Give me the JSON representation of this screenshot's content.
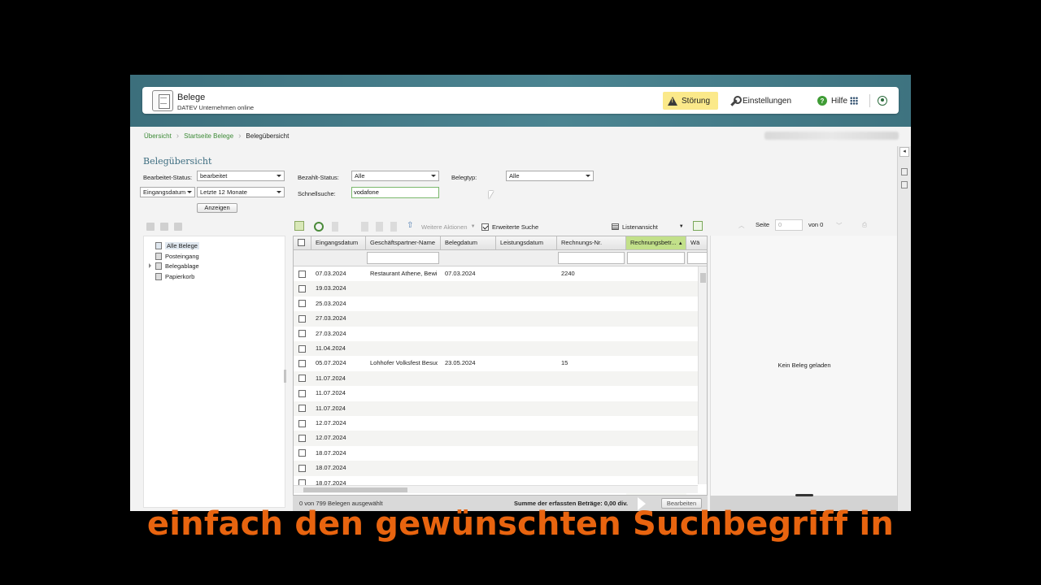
{
  "header": {
    "app_title": "Belege",
    "app_subtitle": "DATEV Unternehmen online",
    "stoerung_label": "Störung",
    "einstellungen_label": "Einstellungen",
    "hilfe_label": "Hilfe"
  },
  "breadcrumb": [
    "Übersicht",
    "Startseite Belege",
    "Belegübersicht"
  ],
  "page_title": "Belegübersicht",
  "filters": {
    "bearbeitet_label": "Bearbeitet-Status:",
    "bearbeitet_value": "bearbeitet",
    "bezahlt_label": "Bezahlt-Status:",
    "bezahlt_value": "Alle",
    "belegtyp_label": "Belegtyp:",
    "belegtyp_value": "Alle",
    "datum_field_value": "Eingangsdatum",
    "datum_range_value": "Letzte 12 Monate",
    "schnellsuche_label": "Schnellsuche:",
    "schnellsuche_value": "vodafone",
    "anzeigen_label": "Anzeigen"
  },
  "tree": {
    "items": [
      "Alle Belege",
      "Posteingang",
      "Belegablage",
      "Papierkorb"
    ],
    "selected": "Alle Belege"
  },
  "grid_toolbar": {
    "weitere_aktionen": "Weitere Aktionen",
    "erweiterte_suche": "Erweiterte Suche",
    "erweiterte_suche_checked": true,
    "ansicht": "Listenansicht"
  },
  "pager": {
    "seite_label": "Seite",
    "seite_value": "0",
    "von_label": "von 0"
  },
  "grid": {
    "columns": [
      "Eingangsdatum",
      "Geschäftspartner-Name",
      "Belegdatum",
      "Leistungsdatum",
      "Rechnungs-Nr.",
      "Rechnungsbetr...",
      "Wä"
    ],
    "sorted_column": "Rechnungsbetr...",
    "rows": [
      {
        "eingang": "07.03.2024",
        "partner": "Restaurant Athene, Bewi",
        "belegdatum": "07.03.2024",
        "leistung": "",
        "nr": "2240",
        "betrag": ""
      },
      {
        "eingang": "19.03.2024",
        "partner": "",
        "belegdatum": "",
        "leistung": "",
        "nr": "",
        "betrag": ""
      },
      {
        "eingang": "25.03.2024",
        "partner": "",
        "belegdatum": "",
        "leistung": "",
        "nr": "",
        "betrag": ""
      },
      {
        "eingang": "27.03.2024",
        "partner": "",
        "belegdatum": "",
        "leistung": "",
        "nr": "",
        "betrag": ""
      },
      {
        "eingang": "27.03.2024",
        "partner": "",
        "belegdatum": "",
        "leistung": "",
        "nr": "",
        "betrag": ""
      },
      {
        "eingang": "11.04.2024",
        "partner": "",
        "belegdatum": "",
        "leistung": "",
        "nr": "",
        "betrag": ""
      },
      {
        "eingang": "05.07.2024",
        "partner": "Lohhofer Volksfest Besuc",
        "belegdatum": "23.05.2024",
        "leistung": "",
        "nr": "15",
        "betrag": ""
      },
      {
        "eingang": "11.07.2024",
        "partner": "",
        "belegdatum": "",
        "leistung": "",
        "nr": "",
        "betrag": ""
      },
      {
        "eingang": "11.07.2024",
        "partner": "",
        "belegdatum": "",
        "leistung": "",
        "nr": "",
        "betrag": ""
      },
      {
        "eingang": "11.07.2024",
        "partner": "",
        "belegdatum": "",
        "leistung": "",
        "nr": "",
        "betrag": ""
      },
      {
        "eingang": "12.07.2024",
        "partner": "",
        "belegdatum": "",
        "leistung": "",
        "nr": "",
        "betrag": ""
      },
      {
        "eingang": "12.07.2024",
        "partner": "",
        "belegdatum": "",
        "leistung": "",
        "nr": "",
        "betrag": ""
      },
      {
        "eingang": "18.07.2024",
        "partner": "",
        "belegdatum": "",
        "leistung": "",
        "nr": "",
        "betrag": ""
      },
      {
        "eingang": "18.07.2024",
        "partner": "",
        "belegdatum": "",
        "leistung": "",
        "nr": "",
        "betrag": ""
      },
      {
        "eingang": "18.07.2024",
        "partner": "",
        "belegdatum": "",
        "leistung": "",
        "nr": "",
        "betrag": ""
      }
    ]
  },
  "statusbar": {
    "selection": "0 von 799 Belegen ausgewählt",
    "summe": "Summe der erfassten Beträge: 0,00 div.",
    "bearbeiten": "Bearbeiten"
  },
  "preview": {
    "empty_message": "Kein Beleg geladen"
  },
  "subtitle": "einfach den gewünschten Suchbegriff in",
  "colors": {
    "banner": "#4b8491",
    "accent_green": "#3c8a36",
    "stoerung_bg": "#fbe98a",
    "sorted_header": "#c2e08a",
    "subtitle": "#e8640f"
  },
  "icons": [
    "document-icon",
    "warning-icon",
    "wrench-icon",
    "help-icon",
    "apps-grid-icon",
    "user-icon",
    "folder-icon",
    "refresh-icon",
    "upload-icon",
    "checkbox-icon",
    "pdf-icon"
  ]
}
